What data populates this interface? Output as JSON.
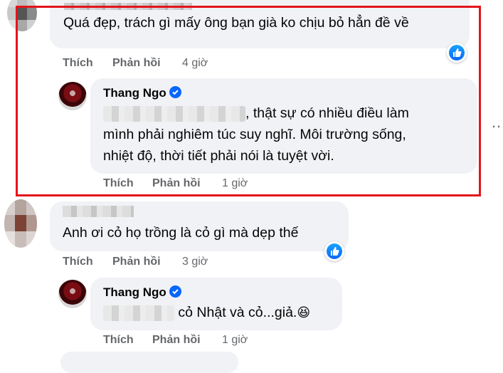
{
  "comments": [
    {
      "author_obscured": "Nguyễn Hoàng Hải",
      "text": "Quá đẹp, trách gì mấy ông bạn già ko chịu bỏ hẳn đề về",
      "actions": {
        "like": "Thích",
        "reply": "Phản hồi",
        "time": "4 giờ"
      },
      "reaction_icon": "like-icon",
      "reply": {
        "author": "Thang Ngo",
        "verified_icon": "verified-badge-icon",
        "text_lines": [
          ", thật sự có nhiều điều làm",
          "mình phải nghiêm túc suy nghĩ. Môi trường sống,",
          "nhiệt độ, thời tiết phải nói là tuyệt vời."
        ],
        "actions": {
          "like": "Thích",
          "reply": "Phản hồi",
          "time": "1 giờ"
        }
      }
    },
    {
      "text": "Anh ơi cỏ họ trồng là cỏ gì mà dẹp thế",
      "actions": {
        "like": "Thích",
        "reply": "Phản hồi",
        "time": "3 giờ"
      },
      "reaction_icon": "like-icon",
      "reply": {
        "author": "Thang Ngo",
        "verified_icon": "verified-badge-icon",
        "text": " cỏ Nhật và cỏ...giả.",
        "emoji": "😆",
        "actions": {
          "like": "Thích",
          "reply": "Phản hồi",
          "time": "1 giờ"
        }
      }
    }
  ],
  "more_icon": "…",
  "colors": {
    "highlight_border": "#e3151b",
    "bubble_bg": "#f0f2f5",
    "secondary_text": "#65676b",
    "facebook_blue": "#0866ff"
  }
}
